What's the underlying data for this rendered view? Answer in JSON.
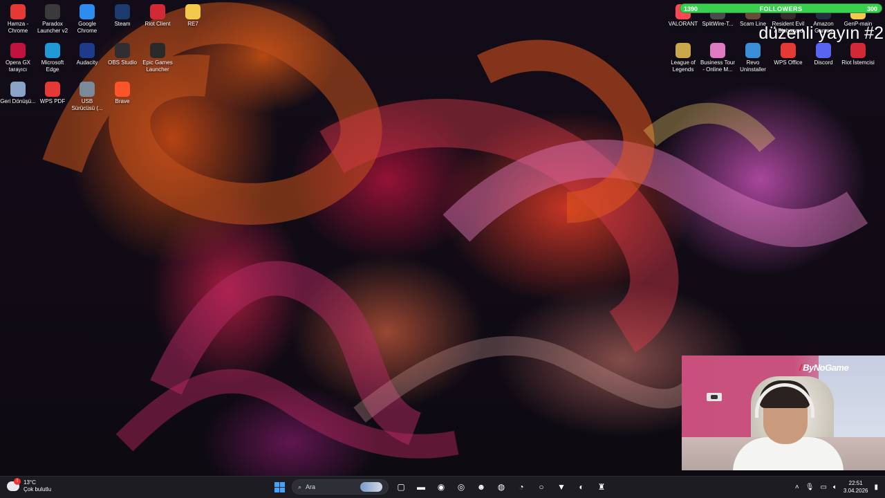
{
  "desktop": {
    "icons": [
      {
        "label": "Hamza - Chrome",
        "icon": "chrome-profile-icon",
        "color": "#e53935"
      },
      {
        "label": "Paradox Launcher v2",
        "icon": "paradox-icon",
        "color": "#3a3a3a"
      },
      {
        "label": "Google Chrome",
        "icon": "chrome-icon",
        "color": "#2d8cf0"
      },
      {
        "label": "Steam",
        "icon": "steam-icon",
        "color": "#1b3b6f"
      },
      {
        "label": "Riot Client",
        "icon": "riot-icon",
        "color": "#d32936"
      },
      {
        "label": "RE7",
        "icon": "folder-icon",
        "color": "#f2c94c"
      },
      {
        "label": "Opera GX tarayıcı",
        "icon": "opera-gx-icon",
        "color": "#c0123c"
      },
      {
        "label": "Microsoft Edge",
        "icon": "edge-icon",
        "color": "#1f9ad6"
      },
      {
        "label": "Audacity",
        "icon": "audacity-icon",
        "color": "#1e3a8a"
      },
      {
        "label": "OBS Studio",
        "icon": "obs-icon",
        "color": "#302e31"
      },
      {
        "label": "Epic Games Launcher",
        "icon": "epic-icon",
        "color": "#2a2a2a"
      },
      {
        "label": "Geri Dönüşü...",
        "icon": "recycle-bin-icon",
        "color": "#8aa4c8"
      },
      {
        "label": "WPS PDF",
        "icon": "wps-pdf-icon",
        "color": "#e53935"
      },
      {
        "label": "USB Sürücüsü (...",
        "icon": "usb-drive-icon",
        "color": "#7a8a9a"
      },
      {
        "label": "Brave",
        "icon": "brave-icon",
        "color": "#fb542b"
      },
      {
        "label": "VALORANT",
        "icon": "valorant-icon",
        "color": "#ff4655"
      },
      {
        "label": "SplitWire-T...",
        "icon": "splitwire-icon",
        "color": "#4a4a4a"
      },
      {
        "label": "Scam Line",
        "icon": "game-icon",
        "color": "#6b4a3a"
      },
      {
        "label": "Resident Evil 7 Biohazard",
        "icon": "re7-icon",
        "color": "#3a2a2a"
      },
      {
        "label": "Amazon Games",
        "icon": "amazon-icon",
        "color": "#232f3e"
      },
      {
        "label": "GenP-main",
        "icon": "folder-icon",
        "color": "#f2c94c"
      },
      {
        "label": "League of Legends",
        "icon": "lol-icon",
        "color": "#c8a84b"
      },
      {
        "label": "Business Tour - Online M...",
        "icon": "business-tour-icon",
        "color": "#e07ac0"
      },
      {
        "label": "Revo Uninstaller",
        "icon": "revo-icon",
        "color": "#3a8ed8"
      },
      {
        "label": "WPS Office",
        "icon": "wps-office-icon",
        "color": "#e53935"
      },
      {
        "label": "Discord",
        "icon": "discord-icon",
        "color": "#5865f2"
      },
      {
        "label": "Riot İstemcisi",
        "icon": "riot-icon",
        "color": "#d32936"
      }
    ]
  },
  "overlay": {
    "followers": {
      "current": "1390",
      "title": "FOLLOWERS",
      "goal": "300",
      "progress": 1.0
    },
    "stream_title": "düzenli yayın #2",
    "webcam_brand": "ByNoGame"
  },
  "taskbar": {
    "weather": {
      "temp": "13°C",
      "condition": "Çok bulutlu"
    },
    "search_placeholder": "Ara",
    "apps": [
      {
        "icon": "task-view-icon",
        "glyph": "▢"
      },
      {
        "icon": "file-explorer-icon",
        "glyph": "▬"
      },
      {
        "icon": "steam-icon",
        "glyph": "◉"
      },
      {
        "icon": "obs-icon",
        "glyph": "◎"
      },
      {
        "icon": "discord-icon",
        "glyph": "☻"
      },
      {
        "icon": "chrome-icon",
        "glyph": "◍"
      },
      {
        "icon": "clock-app-icon",
        "glyph": "◔"
      },
      {
        "icon": "opera-gx-icon",
        "glyph": "○"
      },
      {
        "icon": "brave-icon",
        "glyph": "▼"
      },
      {
        "icon": "edge-icon",
        "glyph": "◐"
      },
      {
        "icon": "app-icon",
        "glyph": "♜"
      }
    ],
    "clock": {
      "time": "22:51",
      "date": "3.04.2026"
    }
  },
  "colors": {
    "taskbar": "#1c1c22",
    "followers_bar": "#37c24a",
    "start": "#3ea6ff"
  }
}
